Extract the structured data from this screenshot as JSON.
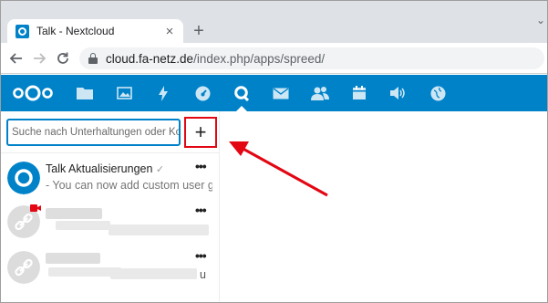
{
  "browser": {
    "tab_title": "Talk - Nextcloud",
    "tab_close": "×",
    "new_tab": "+",
    "window_control": "⌄",
    "url_host": "cloud.fa-netz.de",
    "url_path": "/index.php/apps/spreed/",
    "icons": [
      "back-icon",
      "forward-icon",
      "reload-icon",
      "lock-icon"
    ]
  },
  "header": {
    "brand_color": "#0082c9",
    "apps": [
      "files",
      "photos",
      "activity",
      "dashboard",
      "talk",
      "mail",
      "contacts",
      "calendar",
      "announcements",
      "circles"
    ]
  },
  "sidebar": {
    "search_placeholder": "Suche nach Unterhaltungen oder Kont",
    "new_conversation_label": "+",
    "conversations": [
      {
        "name": "Talk Aktualisierungen",
        "name_suffix": "✓",
        "message": "- You can now add custom user gr...",
        "menu": "•••"
      },
      {
        "name": "",
        "message": "",
        "menu": "•••"
      },
      {
        "name": "",
        "message": "u",
        "menu": "•••"
      }
    ]
  },
  "annotation": {
    "color": "#e30613"
  }
}
